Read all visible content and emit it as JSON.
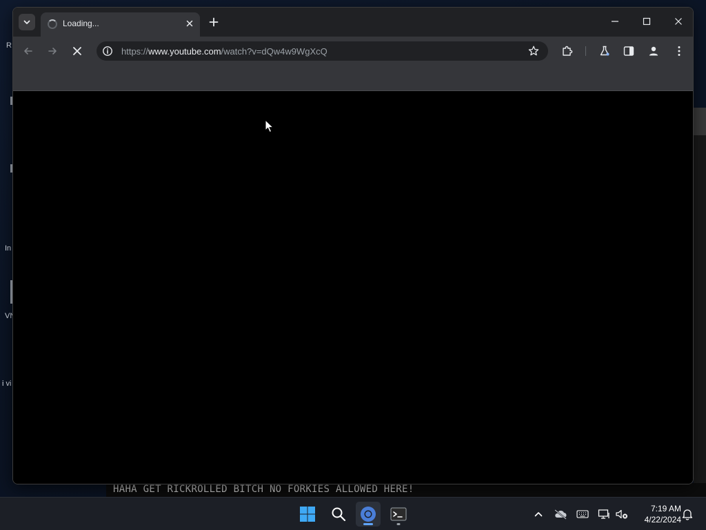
{
  "desktop": {
    "partial_labels": [
      "R",
      "In",
      "VN",
      "i vi"
    ],
    "terminal_text": "HAHA GET RICKROLLED BITCH NO FORKIES ALLOWED HERE!"
  },
  "browser": {
    "tab": {
      "title": "Loading...",
      "state": "loading"
    },
    "toolbar": {
      "url_prefix": "https://",
      "url_host": "www.youtube.com",
      "url_path": "/watch?v=dQw4w9WgXcQ"
    }
  },
  "taskbar": {
    "clock": {
      "time": "7:19 AM",
      "date": "4/22/2024"
    }
  },
  "colors": {
    "accent": "#60a5fa",
    "chrome_dark": "#202124",
    "chrome_toolbar": "#35363a"
  }
}
